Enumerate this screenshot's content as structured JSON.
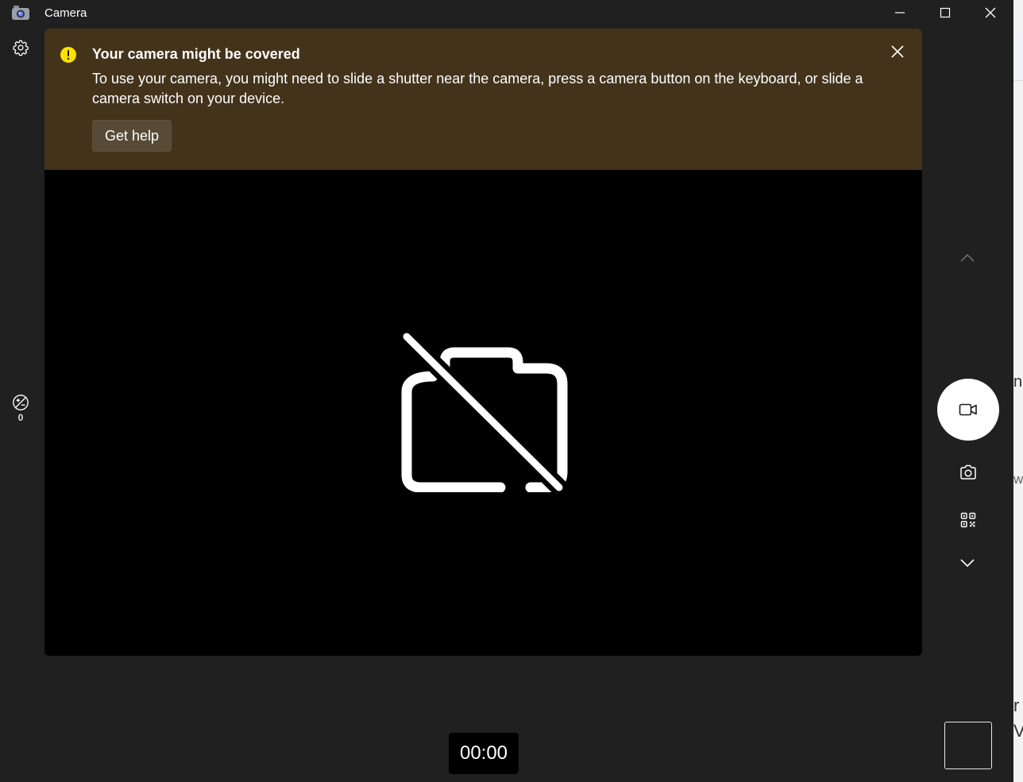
{
  "titlebar": {
    "title": "Camera",
    "icons": {
      "app": "camera-app-icon",
      "minimize": "minimize-icon",
      "maximize": "maximize-icon",
      "close": "close-icon"
    }
  },
  "left_rail": {
    "settings_icon": "gear-icon",
    "hdr_icon": "exposure-icon",
    "hdr_value": "0"
  },
  "banner": {
    "title": "Your camera might be covered",
    "message": "To use your camera, you might need to slide a shutter near the camera, press a camera button on the keyboard, or slide a camera switch on your device.",
    "button": "Get help",
    "icon": "warning-icon",
    "close_icon": "close-icon",
    "background": "#44331b"
  },
  "preview": {
    "status_icon": "camera-off-icon"
  },
  "right_rail": {
    "icons": [
      "chevron-up-icon",
      "video-icon",
      "camera-icon",
      "qr-code-icon",
      "chevron-down-icon"
    ],
    "active_mode": "video"
  },
  "timer": {
    "value": "00:00"
  },
  "desktop": {
    "fragments": [
      "n",
      "w",
      "r",
      "V"
    ]
  },
  "colors": {
    "window_bg": "#202020",
    "preview_bg": "#000000",
    "warning": "#fce100"
  }
}
